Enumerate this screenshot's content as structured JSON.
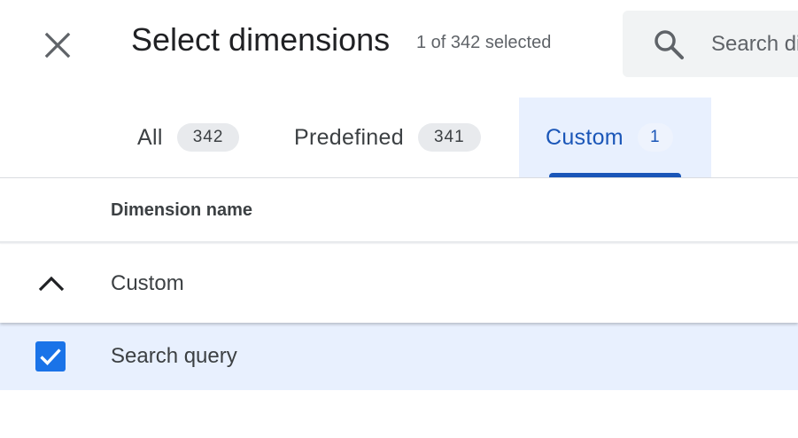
{
  "header": {
    "title": "Select dimensions",
    "selection_status": "1 of 342 selected",
    "close_icon": "close-icon"
  },
  "search": {
    "placeholder": "Search dimensions",
    "icon": "search-icon"
  },
  "tabs": [
    {
      "label": "All",
      "count": "342",
      "selected": false
    },
    {
      "label": "Predefined",
      "count": "341",
      "selected": false
    },
    {
      "label": "Custom",
      "count": "1",
      "selected": true
    }
  ],
  "table": {
    "column_header": "Dimension name",
    "groups": [
      {
        "label": "Custom",
        "expanded": true,
        "icon": "chevron-up-icon",
        "items": [
          {
            "label": "Search query",
            "checked": true
          }
        ]
      }
    ]
  },
  "colors": {
    "accent": "#1a73e8",
    "selected_tab_text": "#1a56b8",
    "selected_bg": "#e8f0fe",
    "text_primary": "#202124",
    "text_secondary": "#5f6368"
  }
}
